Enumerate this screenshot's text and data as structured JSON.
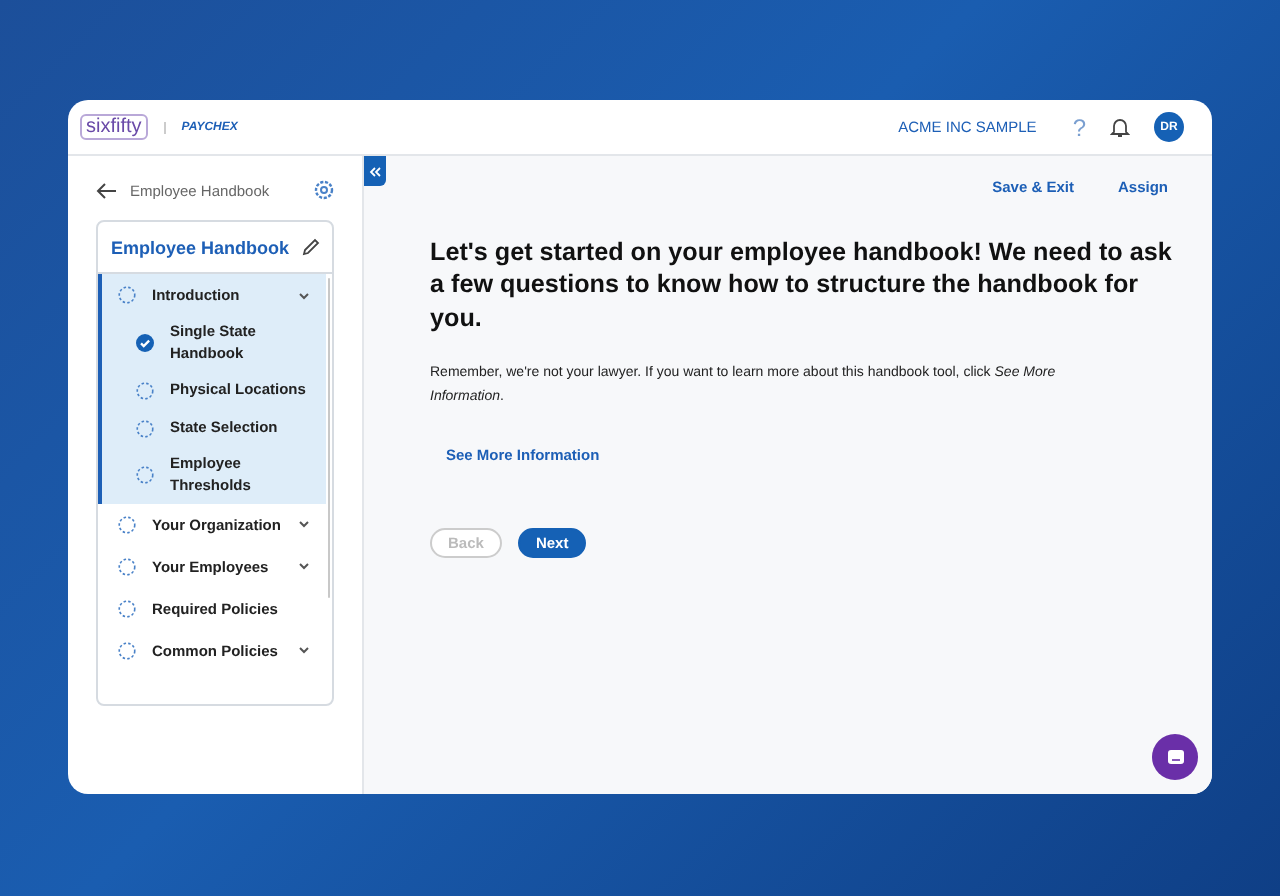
{
  "header": {
    "logo": "sixfifty",
    "partner_logo": "PAYCHEX",
    "company": "ACME INC SAMPLE",
    "help": "?",
    "avatar": "DR"
  },
  "sidebar": {
    "back_label": "Employee Handbook",
    "title": "Employee Handbook",
    "items": [
      {
        "kind": "group",
        "label": "Introduction",
        "complete": false,
        "selected": true,
        "expanded": true,
        "children": [
          {
            "label": "Single State Handbook",
            "complete": true
          },
          {
            "label": "Physical Locations",
            "complete": false
          },
          {
            "label": "State Selection",
            "complete": false
          },
          {
            "label": "Employee Thresholds",
            "complete": false
          }
        ]
      },
      {
        "kind": "group",
        "label": "Your Organization",
        "complete": false,
        "selected": false
      },
      {
        "kind": "group",
        "label": "Your Employees",
        "complete": false,
        "selected": false
      },
      {
        "kind": "page",
        "label": "Required Policies",
        "complete": false,
        "selected": false
      },
      {
        "kind": "group",
        "label": "Common Policies",
        "complete": false,
        "selected": false
      }
    ]
  },
  "toolbar": {
    "actions": [
      "Save & Exit",
      "Assign"
    ]
  },
  "main": {
    "heading": "Let's get started on your employee handbook! We need to ask a few questions to know how to structure the handbook for you.",
    "body": "Remember, we're not your lawyer. If you want to learn more about this handbook tool, click *See More Information*.",
    "link": "See More Information",
    "buttons": [
      {
        "label": "Back",
        "disabled": true
      },
      {
        "label": "Next",
        "disabled": false
      }
    ]
  }
}
